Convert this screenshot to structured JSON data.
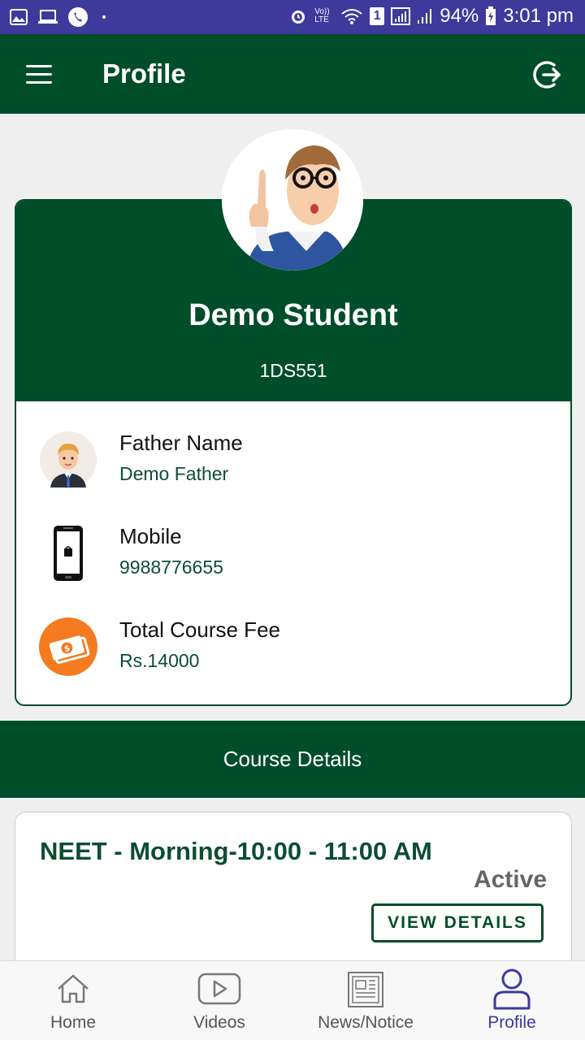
{
  "status_bar": {
    "battery": "94%",
    "time": "3:01 pm",
    "sim_slot": "1",
    "volte_label": "Vo)) LTE"
  },
  "app_bar": {
    "title": "Profile",
    "menu_icon": "hamburger-menu-icon",
    "logout_icon": "logout-icon"
  },
  "profile": {
    "name": "Demo Student",
    "student_id": "1DS551",
    "avatar_icon": "student-avatar",
    "details": [
      {
        "label": "Father Name",
        "value": "Demo Father",
        "icon": "father-avatar-icon"
      },
      {
        "label": "Mobile",
        "value": "9988776655",
        "icon": "mobile-phone-icon"
      },
      {
        "label": "Total Course Fee",
        "value": "Rs.14000",
        "icon": "money-icon"
      }
    ]
  },
  "course_section": {
    "heading": "Course Details",
    "courses": [
      {
        "name": "NEET - Morning-10:00 - 11:00 AM",
        "status": "Active",
        "button": "VIEW DETAILS"
      }
    ]
  },
  "bottom_nav": {
    "items": [
      {
        "label": "Home",
        "icon": "home-icon",
        "active": false
      },
      {
        "label": "Videos",
        "icon": "video-play-icon",
        "active": false
      },
      {
        "label": "News/Notice",
        "icon": "newspaper-icon",
        "active": false
      },
      {
        "label": "Profile",
        "icon": "user-icon",
        "active": true
      }
    ]
  },
  "colors": {
    "primary": "#004d2a",
    "status_bar": "#3d3a9c",
    "value_text": "#0d4d33",
    "fee_icon": "#f47b20"
  }
}
